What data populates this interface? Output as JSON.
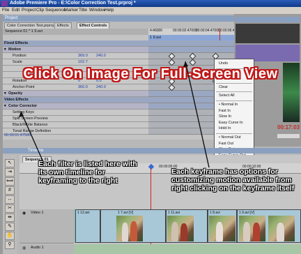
{
  "window": {
    "title": "Adobe Premiere Pro - E:\\Color Correction Test.prproj *"
  },
  "menu": [
    "File",
    "Edit",
    "Project",
    "Clip",
    "Sequence",
    "Marker",
    "Title",
    "Window",
    "Help"
  ],
  "project_panel": {
    "title": "Project"
  },
  "tabs": [
    "Color Correction Test.prproj",
    "Effects",
    "Effect Controls"
  ],
  "effect_controls": {
    "sequence_label": "Sequence 01 * 1 9.avi",
    "ruler": [
      "4:46000",
      "00:00:02:47000",
      "00:00:04:47000",
      "00:00:06:47000"
    ],
    "clip_name": "1 9.avi",
    "rows": [
      {
        "label": "Fixed Effects",
        "type": "section"
      },
      {
        "label": "Motion",
        "type": "sub"
      },
      {
        "label": "Position",
        "v1": "369.0",
        "v2": "240.0",
        "type": "normal"
      },
      {
        "label": "Scale",
        "v1": "102.7",
        "v2": "",
        "type": "normal"
      },
      {
        "label": "",
        "v1": "",
        "v2": "",
        "type": "normal"
      },
      {
        "label": "",
        "v1": "",
        "v2": "",
        "type": "normal"
      },
      {
        "label": "Rotation",
        "v1": "0",
        "v2": "0.0",
        "type": "normal"
      },
      {
        "label": "Anchor Point",
        "v1": "360.0",
        "v2": "240.0",
        "type": "normal"
      },
      {
        "label": "Opacity",
        "type": "sub"
      },
      {
        "label": "Video Effects",
        "type": "section"
      },
      {
        "label": "Color Corrector",
        "type": "sub"
      },
      {
        "label": "Setting Keys",
        "v1": "",
        "v2": "",
        "type": "normal"
      },
      {
        "label": "Split Screen Preview",
        "v1": "",
        "v2": "",
        "type": "normal"
      },
      {
        "label": "Black/White Balance",
        "v1": "",
        "v2": "",
        "type": "normal"
      },
      {
        "label": "Tonal Range Definition",
        "v1": "",
        "v2": "",
        "type": "normal"
      }
    ],
    "timecode": "00:00:01:47500"
  },
  "context_menu": {
    "items": [
      "Undo",
      "Cut",
      "Copy",
      "Clear",
      "Select All",
      "Normal In",
      "Fast In",
      "Slow In",
      "Easy Curve In",
      "Hold In",
      "Normal Out",
      "Fast Out",
      "Slow Out",
      "Easy Curve Out",
      "Hold Out"
    ],
    "checked": [
      "Normal In",
      "Normal Out"
    ]
  },
  "program_monitor": {
    "timecode": "00:17:03"
  },
  "timeline": {
    "title": "Timeline",
    "sequence_tab": "Sequence 01",
    "ruler": [
      "00:00",
      "00:00:05:00",
      "00:00:10:00"
    ],
    "tracks": {
      "video": "Video 1",
      "audio": "Audio 1"
    },
    "clips": [
      "1 12.avi",
      "1 7.avi [V]",
      "1 11.avi",
      "1 8.avi",
      "1 9.avi [V]"
    ]
  },
  "overlay": {
    "banner": "Click On Image For Full-Screen View",
    "callout_left": "Each filter is listed here with its own timeline for keyframing to the right",
    "callout_right": "Each keyframe has options for customizing motion available from right clicking on the keyframe itself"
  }
}
